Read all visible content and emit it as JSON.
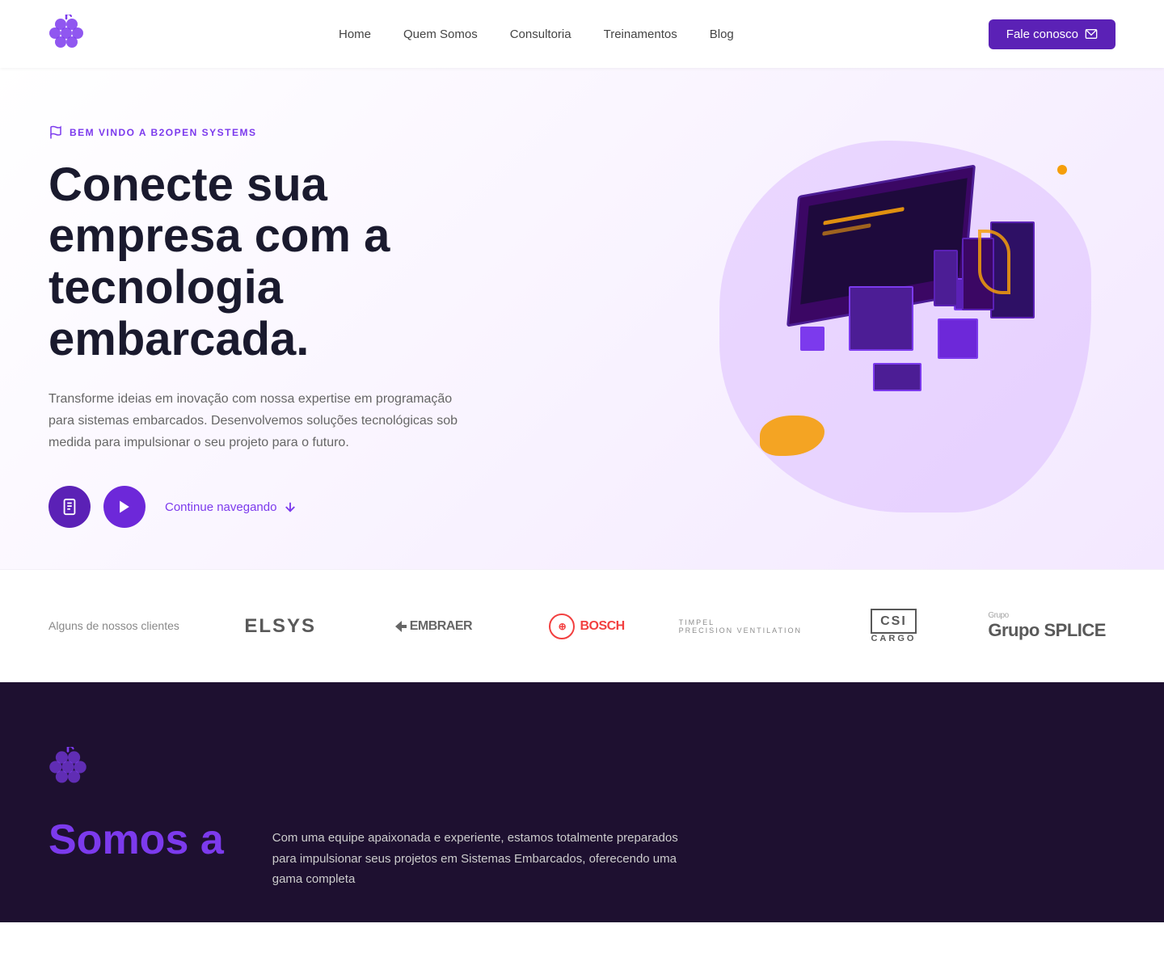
{
  "nav": {
    "logo_alt": "B2Open Systems Logo",
    "links": [
      {
        "label": "Home",
        "href": "#"
      },
      {
        "label": "Quem Somos",
        "href": "#"
      },
      {
        "label": "Consultoria",
        "href": "#"
      },
      {
        "label": "Treinamentos",
        "href": "#"
      },
      {
        "label": "Blog",
        "href": "#"
      }
    ],
    "cta_label": "Fale conosco"
  },
  "hero": {
    "badge": "BEM VINDO A B2OPEN SYSTEMS",
    "title": "Conecte sua empresa com a tecnologia embarcada.",
    "description": "Transforme ideias em inovação com nossa expertise em programação para sistemas embarcados. Desenvolvemos soluções tecnológicas sob medida para impulsionar o seu projeto para o futuro.",
    "continue_label": "Continue navegando"
  },
  "clients": {
    "label": "Alguns de nossos clientes",
    "logos": [
      {
        "name": "Elsys",
        "display": "ELSYS"
      },
      {
        "name": "Embraer",
        "display": "EMBRAER"
      },
      {
        "name": "Bosch",
        "display": "BOSCH"
      },
      {
        "name": "Timpel",
        "display": "TIMPEL",
        "subtitle": "PRECISION VENTILATION"
      },
      {
        "name": "CSI Cargo",
        "display": "CSI CARGO"
      },
      {
        "name": "Grupo Splice",
        "display": "Grupo SPLICE"
      }
    ]
  },
  "dark_section": {
    "logo_alt": "B2Open Systems Logo Dark",
    "title": "Somos a",
    "description": "Com uma equipe apaixonada e experiente, estamos totalmente preparados para impulsionar seus projetos em Sistemas Embarcados, oferecendo uma gama completa"
  },
  "colors": {
    "primary": "#5b21b6",
    "primary_dark": "#3b0764",
    "accent": "#f59e0b",
    "dark_bg": "#1e1030"
  }
}
